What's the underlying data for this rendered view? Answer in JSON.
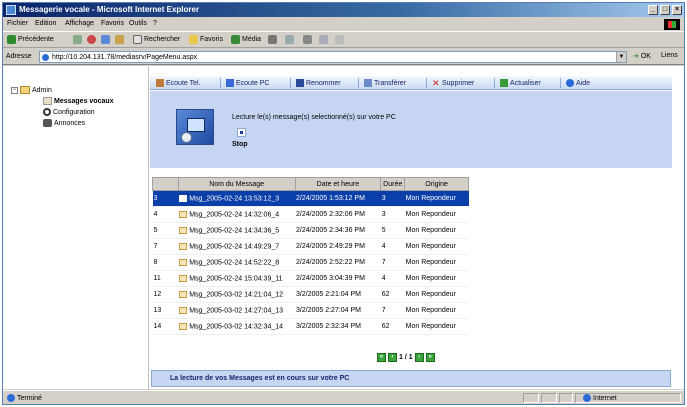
{
  "window": {
    "title": "Messagerie vocale - Microsoft Internet Explorer",
    "min": "_",
    "max": "□",
    "close": "×"
  },
  "menu": [
    "Fichier",
    "Edition",
    "Affichage",
    "Favoris",
    "Outils",
    "?"
  ],
  "toolbar": {
    "back": "Précédente",
    "search": "Rechercher",
    "favorites": "Favoris",
    "media": "Média"
  },
  "address": {
    "label": "Adresse",
    "url": "http://10.204.131.78/mediasrv/PageMenu.aspx",
    "go": "OK",
    "links": "Liens"
  },
  "tree": {
    "root": "Admin",
    "items": [
      "Messages vocaux",
      "Configuration",
      "Annonces"
    ]
  },
  "actions": [
    "Ecoute Tel.",
    "Ecoute PC",
    "Renommer",
    "Transférer",
    "Supprimer",
    "Actualiser",
    "Aide"
  ],
  "player": {
    "text": "Lecture le(s) message(s) selectionné(s) sur votre PC",
    "stop": "Stop"
  },
  "table": {
    "headers": [
      "Nom du Message",
      "Date et heure",
      "Durée",
      "Origine"
    ],
    "rows": [
      {
        "num": "3",
        "name": "Msg_2005-02-24 13:53:12_3",
        "date": "2/24/2005 1:53:12 PM",
        "dur": "3",
        "orig": "Mon Repondeur"
      },
      {
        "num": "4",
        "name": "Msg_2005-02-24 14:32:06_4",
        "date": "2/24/2005 2:32:06 PM",
        "dur": "3",
        "orig": "Mon Repondeur"
      },
      {
        "num": "5",
        "name": "Msg_2005-02-24 14:34:36_5",
        "date": "2/24/2005 2:34:36 PM",
        "dur": "5",
        "orig": "Mon Repondeur"
      },
      {
        "num": "7",
        "name": "Msg_2005-02-24 14:49:29_7",
        "date": "2/24/2005 2:49:29 PM",
        "dur": "4",
        "orig": "Mon Repondeur"
      },
      {
        "num": "8",
        "name": "Msg_2005-02-24 14:52:22_8",
        "date": "2/24/2005 2:52:22 PM",
        "dur": "7",
        "orig": "Mon Repondeur"
      },
      {
        "num": "11",
        "name": "Msg_2005-02-24 15:04:39_11",
        "date": "2/24/2005 3:04:39 PM",
        "dur": "4",
        "orig": "Mon Repondeur"
      },
      {
        "num": "12",
        "name": "Msg_2005-03-02 14:21:04_12",
        "date": "3/2/2005 2:21:04 PM",
        "dur": "62",
        "orig": "Mon Repondeur"
      },
      {
        "num": "13",
        "name": "Msg_2005-03-02 14:27:04_13",
        "date": "3/2/2005 2:27:04 PM",
        "dur": "7",
        "orig": "Mon Repondeur"
      },
      {
        "num": "14",
        "name": "Msg_2005-03-02 14:32:34_14",
        "date": "3/2/2005 2:32:34 PM",
        "dur": "62",
        "orig": "Mon Repondeur"
      }
    ]
  },
  "pager": {
    "first": "«",
    "prev": "‹",
    "label": "1 / 1",
    "next": "›",
    "last": "»"
  },
  "status_message": "La lecture de vos Messages est en cours sur votre PC",
  "statusbar": {
    "left": "Terminé",
    "zone": "Internet"
  }
}
